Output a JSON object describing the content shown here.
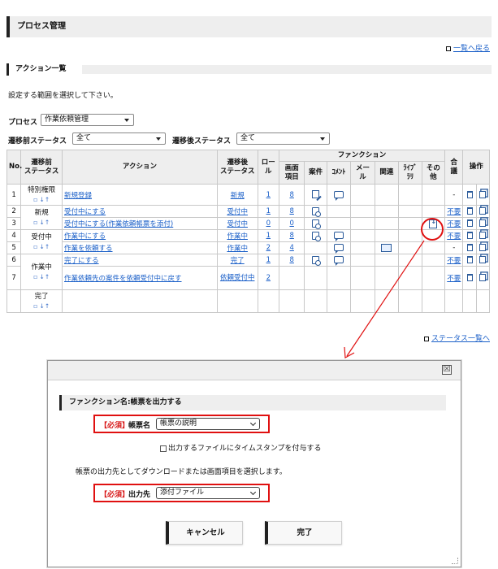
{
  "page_title": "プロセス管理",
  "back_link": "一覧へ戻る",
  "section_title": "アクション一覧",
  "instruction": "設定する範囲を選択して下さい。",
  "filters": {
    "process_label": "プロセス",
    "process_value": "作業依頼管理",
    "pre_status_label": "遷移前ステータス",
    "pre_status_value": "全て",
    "post_status_label": "遷移後ステータス",
    "post_status_value": "全て"
  },
  "table": {
    "headers": {
      "no": "No.",
      "from_status_1": "遷移前",
      "from_status_2": "ステータス",
      "action": "アクション",
      "to_status_1": "遷移後",
      "to_status_2": "ステータス",
      "role": "ロール",
      "functions": "ファンクション",
      "screen_item_1": "画面",
      "screen_item_2": "項目",
      "case": "案件",
      "comment": "ｺﾒﾝﾄ",
      "mail": "メール",
      "relation": "関連",
      "library_1": "ﾗｲﾌﾞ",
      "library_2": "ﾗﾘ",
      "other_1": "その",
      "other_2": "他",
      "approval_1": "合",
      "approval_2": "議",
      "operation": "操作"
    },
    "mini_icons": "▫ ↓↑",
    "rows": [
      {
        "no": "1",
        "from": "特別権限",
        "action": "新規登録",
        "to": "新規",
        "role": "1",
        "screen": "8",
        "approval": "-"
      },
      {
        "no": "2",
        "from": "新規",
        "action": "受付中にする",
        "to": "受付中",
        "role": "1",
        "screen": "8",
        "approval": "不要"
      },
      {
        "no": "3",
        "from": "",
        "action": "受付中にする(作業依頼帳票を添付)",
        "to": "受付中",
        "role": "0",
        "screen": "0",
        "approval": "不要"
      },
      {
        "no": "4",
        "from": "受付中",
        "action": "作業中にする",
        "to": "作業中",
        "role": "1",
        "screen": "8",
        "approval": "不要"
      },
      {
        "no": "5",
        "from": "",
        "action": "作業を依頼する",
        "to": "作業中",
        "role": "2",
        "screen": "4",
        "approval": "-"
      },
      {
        "no": "6",
        "from": "作業中",
        "action": "完了にする",
        "to": "完了",
        "role": "1",
        "screen": "8",
        "approval": "不要"
      },
      {
        "no": "7",
        "from": "",
        "action": "作業依頼先の案件を依頼受付中に戻す",
        "to": "依頼受付中",
        "role": "2",
        "screen": "",
        "approval": "不要"
      },
      {
        "no": "",
        "from": "完了",
        "action": "",
        "to": "",
        "role": "",
        "screen": "",
        "approval": ""
      }
    ]
  },
  "status_link": "ステータス一覧へ",
  "modal": {
    "close": "☒",
    "section_title": "ファンクション名:帳票を出力する",
    "required": "【必須】",
    "form_name_label": "帳票名",
    "form_name_value": "帳票の説明",
    "timestamp_label": "出力するファイルにタイムスタンプを付与する",
    "output_note": "帳票の出力先としてダウンロードまたは画面項目を選択します。",
    "output_label": "出力先",
    "output_value": "添付ファイル",
    "cancel": "キャンセル",
    "done": "完了"
  },
  "colors": {
    "highlight": "#e01010",
    "link": "#1a5fc8",
    "header_bg": "#eeeeee"
  }
}
